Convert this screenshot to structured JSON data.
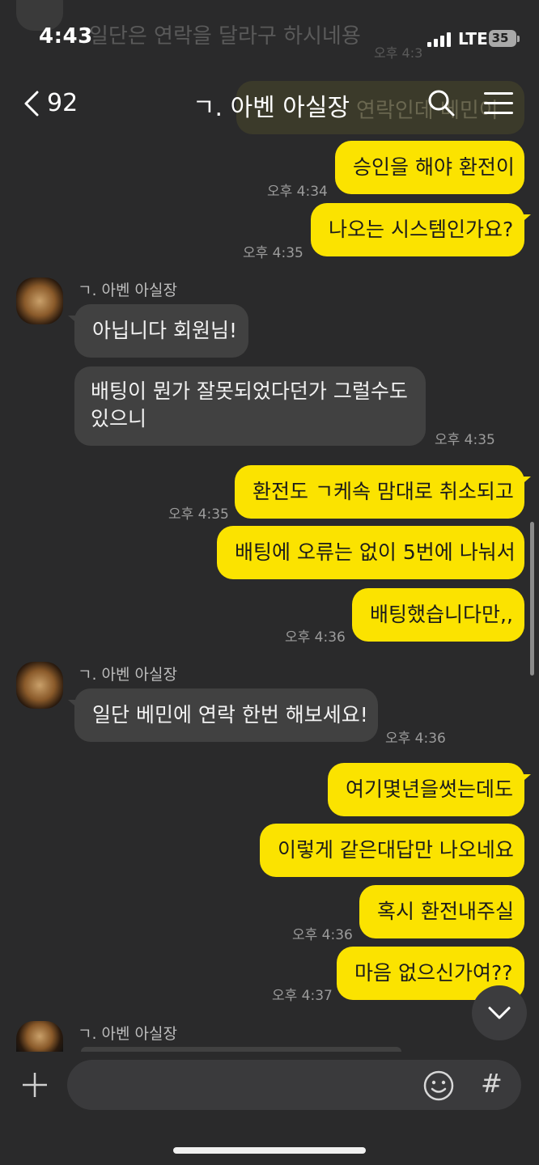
{
  "status_bar": {
    "time": "4:43",
    "network": "LTE",
    "battery": "35"
  },
  "header": {
    "back_count": "92",
    "title": "ㄱ. 아벤 아실장"
  },
  "ghost": {
    "top_text": "일단은 연락을 달라구 하시네용",
    "top_time": "오후 4:3",
    "bubble_text": "연락인데 베민이"
  },
  "messages": [
    {
      "text": "승인을 해야 환전이",
      "time": ""
    },
    {
      "text": "나오는 시스템인가요?",
      "time": "오후 4:35"
    },
    {
      "text": "",
      "time": "오후 4:34"
    }
  ],
  "chat": {
    "m1": {
      "text": "승인을 해야 환전이",
      "time": "오후 4:34"
    },
    "m2": {
      "text": "나오는 시스템인가요?",
      "time": "오후 4:35"
    },
    "sender_name": "ㄱ. 아벤 아실장",
    "r1": {
      "text": "아닙니다 회원님!"
    },
    "r2": {
      "text": "배팅이 뭔가 잘못되었다던가 그럴수도 있으니",
      "time": "오후 4:35"
    },
    "m3": {
      "text": "환전도 ㄱ케속 맘대로 취소되고",
      "time": "오후 4:35"
    },
    "m4": {
      "text": "배팅에 오류는 없이 5번에 나눠서"
    },
    "m5": {
      "text": "배팅했습니다만,,",
      "time": "오후 4:36"
    },
    "r3": {
      "text": "일단 베민에 연락 한번 해보세요!",
      "time": "오후 4:36"
    },
    "m6": {
      "text": "여기몇년을썻는데도"
    },
    "m7": {
      "text": "이렇게 같은대답만 나오네요"
    },
    "m8": {
      "text": "혹시 환전내주실",
      "time": "오후 4:36"
    },
    "m9": {
      "text": "마음 없으신가여??",
      "time": "오후 4:37"
    }
  },
  "input": {
    "placeholder": ""
  },
  "icons": {
    "back": "chevron-left-icon",
    "search": "search-icon",
    "menu": "menu-icon",
    "plus": "plus-icon",
    "emoji": "emoji-icon",
    "hash": "hash-icon",
    "scroll": "chevron-down-icon"
  },
  "colors": {
    "background": "#2a2a2b",
    "my_bubble": "#fbe300",
    "their_bubble": "#414141",
    "timestamp": "#9c9c9c"
  }
}
